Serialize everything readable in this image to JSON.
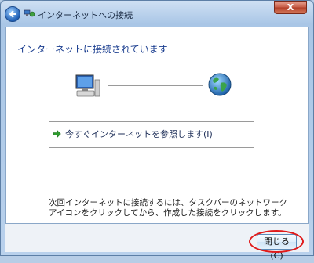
{
  "window": {
    "title": "インターネットへの接続",
    "close_glyph": "X"
  },
  "content": {
    "heading": "インターネットに接続されています",
    "browse_option": "今すぐインターネットを参照します(I)",
    "info_line1": "次回インターネットに接続するには、タスクバーのネットワーク",
    "info_line2": "アイコンをクリックしてから、作成した接続をクリックします。"
  },
  "footer": {
    "close_button": "閉じる(C)"
  },
  "icons": {
    "back": "back-arrow-icon",
    "title": "network-icon",
    "computer": "computer-icon",
    "globe": "globe-icon",
    "option": "green-arrow-icon"
  },
  "colors": {
    "heading": "#1a3d8f",
    "highlight": "#e01a1a",
    "close_window": "#c65b45"
  }
}
